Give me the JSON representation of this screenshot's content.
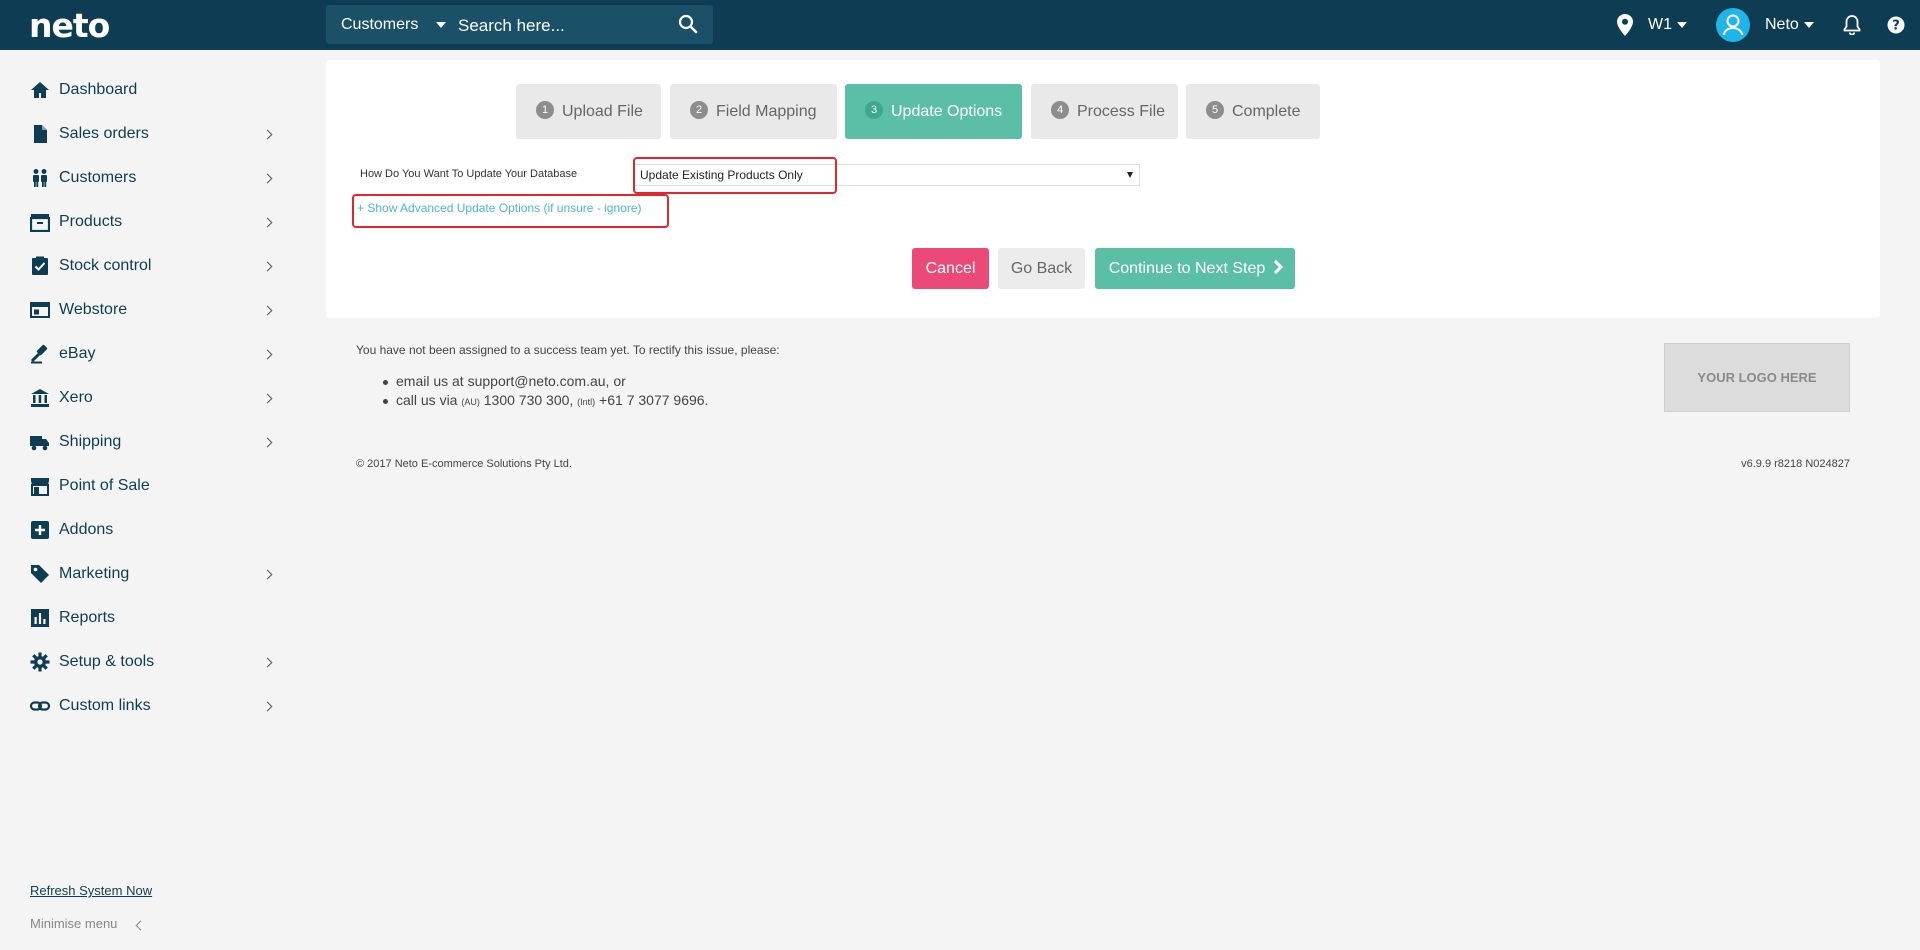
{
  "topbar": {
    "logo": "neto",
    "search_scope": "Customers",
    "search_placeholder": "Search here...",
    "location": "W1",
    "user": "Neto"
  },
  "sidebar": {
    "items": [
      {
        "label": "Dashboard",
        "icon": "home-icon",
        "has_submenu": false
      },
      {
        "label": "Sales orders",
        "icon": "document-icon",
        "has_submenu": true
      },
      {
        "label": "Customers",
        "icon": "customers-icon",
        "has_submenu": true
      },
      {
        "label": "Products",
        "icon": "box-icon",
        "has_submenu": true
      },
      {
        "label": "Stock control",
        "icon": "clipboard-check-icon",
        "has_submenu": true
      },
      {
        "label": "Webstore",
        "icon": "browser-icon",
        "has_submenu": true
      },
      {
        "label": "eBay",
        "icon": "gavel-icon",
        "has_submenu": true
      },
      {
        "label": "Xero",
        "icon": "bank-icon",
        "has_submenu": true
      },
      {
        "label": "Shipping",
        "icon": "truck-icon",
        "has_submenu": true
      },
      {
        "label": "Point of Sale",
        "icon": "store-icon",
        "has_submenu": false
      },
      {
        "label": "Addons",
        "icon": "plus-square-icon",
        "has_submenu": false
      },
      {
        "label": "Marketing",
        "icon": "tag-icon",
        "has_submenu": true
      },
      {
        "label": "Reports",
        "icon": "bar-chart-icon",
        "has_submenu": false
      },
      {
        "label": "Setup & tools",
        "icon": "gear-icon",
        "has_submenu": true
      },
      {
        "label": "Custom links",
        "icon": "link-icon",
        "has_submenu": true
      }
    ],
    "refresh": "Refresh System Now",
    "minimise": "Minimise menu"
  },
  "wizard": {
    "steps": [
      {
        "num": "1",
        "label": "Upload File",
        "active": false
      },
      {
        "num": "2",
        "label": "Field Mapping",
        "active": false
      },
      {
        "num": "3",
        "label": "Update Options",
        "active": true
      },
      {
        "num": "4",
        "label": "Process File",
        "active": false
      },
      {
        "num": "5",
        "label": "Complete",
        "active": false
      }
    ],
    "update_label": "How Do You Want To Update Your Database",
    "update_value": "Update Existing Products Only",
    "advanced_link": "+ Show Advanced Update Options (if unsure - ignore)",
    "cancel": "Cancel",
    "back": "Go Back",
    "next": "Continue to Next Step"
  },
  "footer": {
    "support_intro": "You have not been assigned to a success team yet. To rectify this issue, please:",
    "email_line": "email us at support@neto.com.au, or",
    "call_prefix": "call us via ",
    "au_tag": "(AU)",
    "au_number": " 1300 730 300, ",
    "intl_tag": "(Intl)",
    "intl_number": " +61 7 3077 9696.",
    "logo_placeholder": "YOUR LOGO HERE",
    "copyright": "© 2017 Neto E-commerce Solutions Pty Ltd.",
    "version": "v6.9.9 r8218 N024827"
  },
  "colors": {
    "topbar": "#0e3d53",
    "accent": "#5bbfa5",
    "cancel": "#eb4a78",
    "link": "#4fb3d6",
    "highlight": "#e0262e"
  }
}
